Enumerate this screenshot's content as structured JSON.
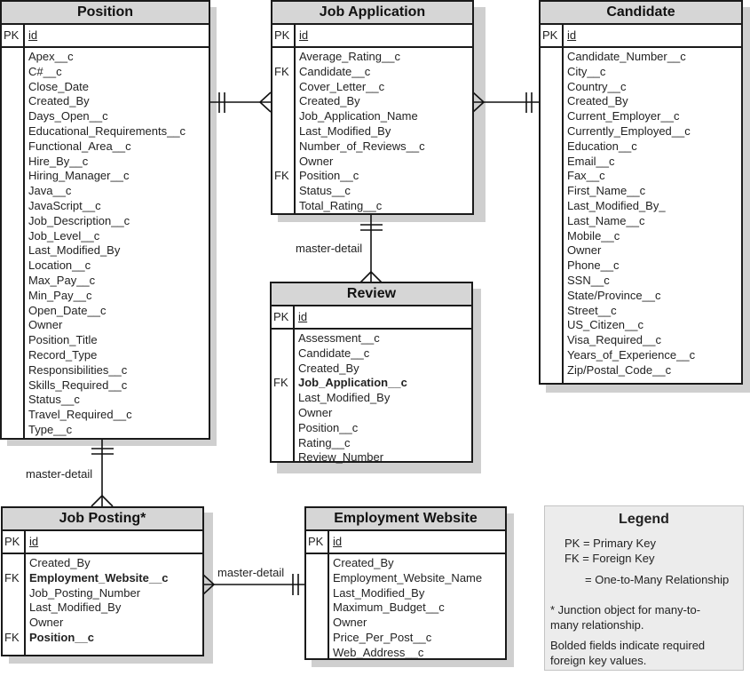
{
  "diagram": {
    "entities": {
      "position": {
        "title": "Position",
        "pk_label": "PK",
        "pk_field": "id",
        "fields": [
          {
            "key": "",
            "name": "Apex__c",
            "bold": false
          },
          {
            "key": "",
            "name": "C#__c",
            "bold": false
          },
          {
            "key": "",
            "name": "Close_Date",
            "bold": false
          },
          {
            "key": "",
            "name": "Created_By",
            "bold": false
          },
          {
            "key": "",
            "name": "Days_Open__c",
            "bold": false
          },
          {
            "key": "",
            "name": "Educational_Requirements__c",
            "bold": false
          },
          {
            "key": "",
            "name": "Functional_Area__c",
            "bold": false
          },
          {
            "key": "",
            "name": "Hire_By__c",
            "bold": false
          },
          {
            "key": "",
            "name": "Hiring_Manager__c",
            "bold": false
          },
          {
            "key": "",
            "name": "Java__c",
            "bold": false
          },
          {
            "key": "",
            "name": "JavaScript__c",
            "bold": false
          },
          {
            "key": "",
            "name": "Job_Description__c",
            "bold": false
          },
          {
            "key": "",
            "name": "Job_Level__c",
            "bold": false
          },
          {
            "key": "",
            "name": "Last_Modified_By",
            "bold": false
          },
          {
            "key": "",
            "name": "Location__c",
            "bold": false
          },
          {
            "key": "",
            "name": "Max_Pay__c",
            "bold": false
          },
          {
            "key": "",
            "name": "Min_Pay__c",
            "bold": false
          },
          {
            "key": "",
            "name": "Open_Date__c",
            "bold": false
          },
          {
            "key": "",
            "name": "Owner",
            "bold": false
          },
          {
            "key": "",
            "name": "Position_Title",
            "bold": false
          },
          {
            "key": "",
            "name": "Record_Type",
            "bold": false
          },
          {
            "key": "",
            "name": "Responsibilities__c",
            "bold": false
          },
          {
            "key": "",
            "name": "Skills_Required__c",
            "bold": false
          },
          {
            "key": "",
            "name": "Status__c",
            "bold": false
          },
          {
            "key": "",
            "name": "Travel_Required__c",
            "bold": false
          },
          {
            "key": "",
            "name": "Type__c",
            "bold": false
          }
        ]
      },
      "job_application": {
        "title": "Job Application",
        "pk_label": "PK",
        "pk_field": "id",
        "fields": [
          {
            "key": "",
            "name": "Average_Rating__c",
            "bold": false
          },
          {
            "key": "FK",
            "name": "Candidate__c",
            "bold": false
          },
          {
            "key": "",
            "name": "Cover_Letter__c",
            "bold": false
          },
          {
            "key": "",
            "name": "Created_By",
            "bold": false
          },
          {
            "key": "",
            "name": "Job_Application_Name",
            "bold": false
          },
          {
            "key": "",
            "name": "Last_Modified_By",
            "bold": false
          },
          {
            "key": "",
            "name": "Number_of_Reviews__c",
            "bold": false
          },
          {
            "key": "",
            "name": "Owner",
            "bold": false
          },
          {
            "key": "FK",
            "name": "Position__c",
            "bold": false
          },
          {
            "key": "",
            "name": "Status__c",
            "bold": false
          },
          {
            "key": "",
            "name": "Total_Rating__c",
            "bold": false
          }
        ]
      },
      "candidate": {
        "title": "Candidate",
        "pk_label": "PK",
        "pk_field": "id",
        "fields": [
          {
            "key": "",
            "name": "Candidate_Number__c",
            "bold": false
          },
          {
            "key": "",
            "name": "City__c",
            "bold": false
          },
          {
            "key": "",
            "name": "Country__c",
            "bold": false
          },
          {
            "key": "",
            "name": "Created_By",
            "bold": false
          },
          {
            "key": "",
            "name": "Current_Employer__c",
            "bold": false
          },
          {
            "key": "",
            "name": "Currently_Employed__c",
            "bold": false
          },
          {
            "key": "",
            "name": "Education__c",
            "bold": false
          },
          {
            "key": "",
            "name": "Email__c",
            "bold": false
          },
          {
            "key": "",
            "name": "Fax__c",
            "bold": false
          },
          {
            "key": "",
            "name": "First_Name__c",
            "bold": false
          },
          {
            "key": "",
            "name": "Last_Modified_By_",
            "bold": false
          },
          {
            "key": "",
            "name": "Last_Name__c",
            "bold": false
          },
          {
            "key": "",
            "name": "Mobile__c",
            "bold": false
          },
          {
            "key": "",
            "name": "Owner",
            "bold": false
          },
          {
            "key": "",
            "name": "Phone__c",
            "bold": false
          },
          {
            "key": "",
            "name": "SSN__c",
            "bold": false
          },
          {
            "key": "",
            "name": "State/Province__c",
            "bold": false
          },
          {
            "key": "",
            "name": "Street__c",
            "bold": false
          },
          {
            "key": "",
            "name": "US_Citizen__c",
            "bold": false
          },
          {
            "key": "",
            "name": "Visa_Required__c",
            "bold": false
          },
          {
            "key": "",
            "name": "Years_of_Experience__c",
            "bold": false
          },
          {
            "key": "",
            "name": "Zip/Postal_Code__c",
            "bold": false
          }
        ]
      },
      "review": {
        "title": "Review",
        "pk_label": "PK",
        "pk_field": "id",
        "fields": [
          {
            "key": "",
            "name": "Assessment__c",
            "bold": false
          },
          {
            "key": "",
            "name": "Candidate__c",
            "bold": false
          },
          {
            "key": "",
            "name": "Created_By",
            "bold": false
          },
          {
            "key": "FK",
            "name": "Job_Application__c",
            "bold": true
          },
          {
            "key": "",
            "name": "Last_Modified_By",
            "bold": false
          },
          {
            "key": "",
            "name": "Owner",
            "bold": false
          },
          {
            "key": "",
            "name": "Position__c",
            "bold": false
          },
          {
            "key": "",
            "name": "Rating__c",
            "bold": false
          },
          {
            "key": "",
            "name": "Review_Number",
            "bold": false
          }
        ]
      },
      "job_posting": {
        "title": "Job Posting*",
        "pk_label": "PK",
        "pk_field": "id",
        "fields": [
          {
            "key": "",
            "name": "Created_By",
            "bold": false
          },
          {
            "key": "FK",
            "name": "Employment_Website__c",
            "bold": true
          },
          {
            "key": "",
            "name": "Job_Posting_Number",
            "bold": false
          },
          {
            "key": "",
            "name": "Last_Modified_By",
            "bold": false
          },
          {
            "key": "",
            "name": "Owner",
            "bold": false
          },
          {
            "key": "FK",
            "name": "Position__c",
            "bold": true
          }
        ]
      },
      "employment_website": {
        "title": "Employment Website",
        "pk_label": "PK",
        "pk_field": "id",
        "fields": [
          {
            "key": "",
            "name": "Created_By",
            "bold": false
          },
          {
            "key": "",
            "name": "Employment_Website_Name",
            "bold": false
          },
          {
            "key": "",
            "name": "Last_Modified_By",
            "bold": false
          },
          {
            "key": "",
            "name": "Maximum_Budget__c",
            "bold": false
          },
          {
            "key": "",
            "name": "Owner",
            "bold": false
          },
          {
            "key": "",
            "name": "Price_Per_Post__c",
            "bold": false
          },
          {
            "key": "",
            "name": "Web_Address__c",
            "bold": false
          }
        ]
      }
    },
    "relationships": [
      {
        "from": "Position",
        "to": "Job Application",
        "type": "one-to-many",
        "label": ""
      },
      {
        "from": "Candidate",
        "to": "Job Application",
        "type": "one-to-many",
        "label": ""
      },
      {
        "from": "Job Application",
        "to": "Review",
        "type": "one-to-many",
        "label": "master-detail"
      },
      {
        "from": "Position",
        "to": "Job Posting*",
        "type": "one-to-many",
        "label": "master-detail"
      },
      {
        "from": "Employment Website",
        "to": "Job Posting*",
        "type": "one-to-many",
        "label": "master-detail"
      }
    ],
    "labels": {
      "ja_review": "master-detail",
      "pos_jobposting": "master-detail",
      "ew_jobposting": "master-detail"
    },
    "legend": {
      "title": "Legend",
      "pk": "PK = Primary Key",
      "fk": "FK = Foreign Key",
      "relationship": "= One-to-Many Relationship",
      "junction_note": "* Junction object for many-to-many relationship.",
      "bold_note": "Bolded fields indicate required foreign key values."
    }
  }
}
